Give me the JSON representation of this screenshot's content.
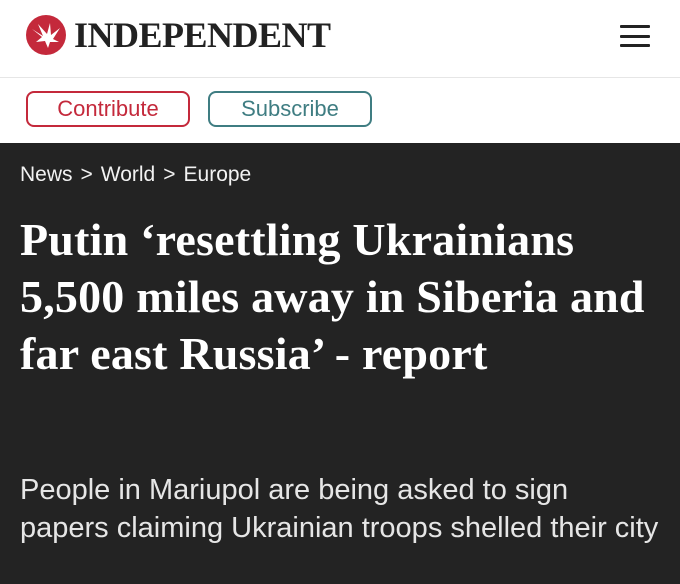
{
  "brand": {
    "name": "INDEPENDENT",
    "accent": "#c4293b"
  },
  "header": {
    "menu_icon": "hamburger-menu-icon"
  },
  "actions": {
    "contribute_label": "Contribute",
    "subscribe_label": "Subscribe"
  },
  "breadcrumb": {
    "items": [
      "News",
      "World",
      "Europe"
    ],
    "separator": ">"
  },
  "article": {
    "headline": "Putin ‘resettling Ukrainians 5,500 miles away in Siberia and far east Russia’ - report",
    "standfirst": "People in Mariupol are being asked to sign papers claiming Ukrainian troops shelled their city"
  }
}
